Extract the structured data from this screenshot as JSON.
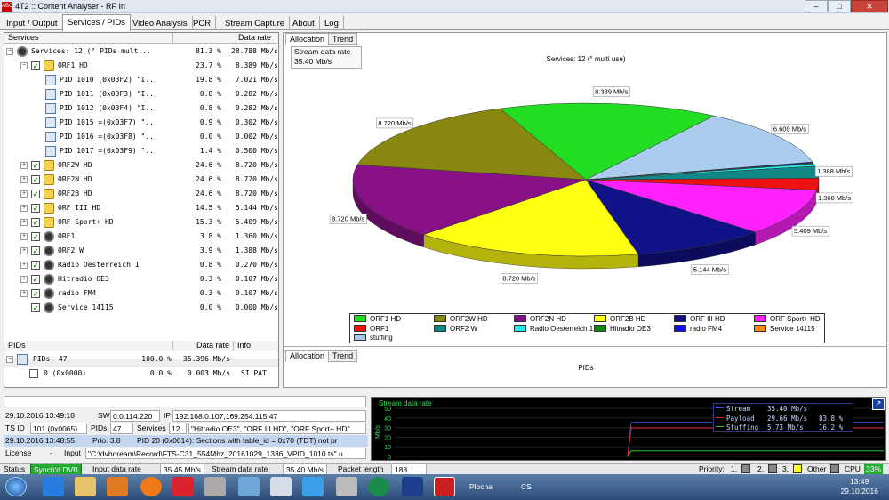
{
  "window": {
    "title": "4T2 :: Content Analyser - RF In",
    "min": "–",
    "max": "□",
    "close": "✕",
    "app_icon_text": "ABC"
  },
  "tabs": [
    "Input / Output",
    "Services / PIDs",
    "Video Analysis",
    "PCR",
    "Stream Capture",
    "About",
    "Log"
  ],
  "services_header": {
    "col1": "Services",
    "col2": "Data rate"
  },
  "services_rows": [
    {
      "exp": "⊟",
      "name": "Services: 12 (° PIDs mult...",
      "pct": "81.3 %",
      "rate": "28.788 Mb/s"
    },
    {
      "exp": "⊟",
      "name": "ORF1 HD",
      "pct": "23.7 %",
      "rate": "8.389 Mb/s"
    },
    {
      "name": "PID 1010 (0x03F2) \"I...",
      "pct": "19.8 %",
      "rate": "7.021 Mb/s"
    },
    {
      "name": "PID 1011 (0x03F3) \"I...",
      "pct": "0.8 %",
      "rate": "0.282 Mb/s"
    },
    {
      "name": "PID 1012 (0x03F4) \"I...",
      "pct": "0.8 %",
      "rate": "0.282 Mb/s"
    },
    {
      "name": "PID 1015 =(0x03F7) \"...",
      "pct": "0.9 %",
      "rate": "0.302 Mb/s"
    },
    {
      "name": "PID 1016 =(0x03F8) \"...",
      "pct": "0.0 %",
      "rate": "0.002 Mb/s"
    },
    {
      "name": "PID 1017 =(0x03F9) \"...",
      "pct": "1.4 %",
      "rate": "0.500 Mb/s"
    },
    {
      "exp": "⊞",
      "name": "ORF2W HD",
      "pct": "24.6 %",
      "rate": "8.720 Mb/s"
    },
    {
      "exp": "⊞",
      "name": "ORF2N HD",
      "pct": "24.6 %",
      "rate": "8.720 Mb/s"
    },
    {
      "exp": "⊞",
      "name": "ORF2B HD",
      "pct": "24.6 %",
      "rate": "8.720 Mb/s"
    },
    {
      "exp": "⊞",
      "name": "ORF III HD",
      "pct": "14.5 %",
      "rate": "5.144 Mb/s"
    },
    {
      "exp": "⊞",
      "name": "ORF Sport+ HD",
      "pct": "15.3 %",
      "rate": "5.409 Mb/s"
    },
    {
      "exp": "⊞",
      "name": "ORF1",
      "pct": "3.8 %",
      "rate": "1.360 Mb/s"
    },
    {
      "exp": "⊞",
      "name": "ORF2 W",
      "pct": "3.9 %",
      "rate": "1.388 Mb/s"
    },
    {
      "exp": "⊞",
      "name": "Radio Oesterreich 1",
      "pct": "0.8 %",
      "rate": "0.270 Mb/s"
    },
    {
      "exp": "⊞",
      "name": "Hitradio OE3",
      "pct": "0.3 %",
      "rate": "0.107 Mb/s"
    },
    {
      "exp": "⊞",
      "name": "radio FM4",
      "pct": "0.3 %",
      "rate": "0.107 Mb/s"
    },
    {
      "name": "Service 14115",
      "pct": "0.0 %",
      "rate": "0.000 Mb/s"
    }
  ],
  "pids_header": {
    "col1": "PIDs",
    "col2": "Data rate",
    "col3": "Info"
  },
  "pids_rows": [
    {
      "exp": "⊟",
      "name": "PIDs: 47",
      "pct": "100.0 %",
      "rate": "35.396 Mb/s",
      "info": ""
    },
    {
      "name": "0 (0x0000)",
      "pct": "0.0 %",
      "rate": "0.003 Mb/s",
      "info": "SI PAT"
    }
  ],
  "right_tabs": [
    "Allocation",
    "Trend"
  ],
  "stream_rate": {
    "label": "Stream data rate",
    "value": "35.40 Mb/s"
  },
  "pie_title": "Services: 12 (° multi use)",
  "pids_title": "PIDs",
  "colors": {
    "ORF1 HD": "#22dd22",
    "ORF2W HD": "#888811",
    "ORF2N HD": "#881188",
    "ORF2B HD": "#ffff11",
    "ORF III HD": "#111188",
    "ORF Sport+ HD": "#ff22ff",
    "ORF1": "#ee1111",
    "ORF2 W": "#118888",
    "Radio Oesterreich 1": "#22eeee",
    "Hitradio OE3": "#118811",
    "radio FM4": "#1111ee",
    "Service 14115": "#ff8811",
    "stuffing": "#aaccee"
  },
  "chart_data": {
    "type": "pie",
    "title": "Services: 12 (° multi use)",
    "slices": [
      {
        "name": "ORF1 HD",
        "value": 8.389,
        "label": "8.389 Mb/s"
      },
      {
        "name": "stuffing",
        "value": 6.609,
        "label": "6.609 Mb/s"
      },
      {
        "name": "radio FM4",
        "value": 0.107,
        "label": ""
      },
      {
        "name": "Hitradio OE3",
        "value": 0.107,
        "label": ""
      },
      {
        "name": "Radio Oesterreich 1",
        "value": 0.27,
        "label": ""
      },
      {
        "name": "ORF2 W",
        "value": 1.388,
        "label": "1.388 Mb/s"
      },
      {
        "name": "ORF1",
        "value": 1.36,
        "label": "1.360 Mb/s"
      },
      {
        "name": "ORF Sport+ HD",
        "value": 5.409,
        "label": "5.409 Mb/s"
      },
      {
        "name": "ORF III HD",
        "value": 5.144,
        "label": "5.144 Mb/s"
      },
      {
        "name": "ORF2B HD",
        "value": 8.72,
        "label": "8.720 Mb/s"
      },
      {
        "name": "ORF2N HD",
        "value": 8.72,
        "label": "8.720 Mb/s"
      },
      {
        "name": "ORF2W HD",
        "value": 8.72,
        "label": "8.720 Mb/s"
      }
    ],
    "legend": [
      "ORF1 HD",
      "ORF2W HD",
      "ORF2N HD",
      "ORF2B HD",
      "ORF III HD",
      "ORF Sport+ HD",
      "ORF1",
      "ORF2 W",
      "Radio Oesterreich 1",
      "Hitradio OE3",
      "radio FM4",
      "Service 14115",
      "stuffing"
    ]
  },
  "info": {
    "r1_time": "29.10.2016 13:49:18",
    "r1_sw_label": "SW",
    "r1_sw": "0.0.114.220",
    "r1_ip_label": "IP",
    "r1_ip": "192.168.0.107,169.254.115.47",
    "r2_tsid_label": "TS ID",
    "r2_tsid": "101 (0x0065)",
    "r2_pids_label": "PIDs",
    "r2_pids": "47",
    "r2_services_label": "Services",
    "r2_services": "12",
    "r2_names": "\"Hitradio OE3\", \"ORF III HD\", \"ORF Sport+ HD\"",
    "r3_time": "29.10.2016 13:48:55",
    "r3_prio": "Prio. 3.8",
    "r3_msg": "PID 20 (0x0014): Sections with table_id = 0x70 (TDT) not pr",
    "r4_license": "License",
    "r4_dash": "-",
    "r4_input_label": "Input",
    "r4_input": "\"C:\\dvbdream\\Record\\FTS-C31_554Mhz_20161029_1336_VPID_1010.ts\" u"
  },
  "graph": {
    "title": "Stream data rate",
    "ylabel": "Mb/s",
    "yticks": [
      "50",
      "40",
      "30",
      "20",
      "10",
      "0"
    ],
    "legend": [
      {
        "name": "Stream",
        "value": "35.40 Mb/s",
        "pct": "",
        "color": "#3355ff"
      },
      {
        "name": "Payload",
        "value": "29.66 Mb/s",
        "pct": "83.8 %",
        "color": "#ee2222"
      },
      {
        "name": "Stuffing",
        "value": "5.73 Mb/s",
        "pct": "16.2 %",
        "color": "#22cc22"
      }
    ],
    "zoom": "↗"
  },
  "status": {
    "status_label": "Status",
    "status_value": "Synch'd DVB",
    "input_label": "Input data rate",
    "input_value": "35.45 Mb/s",
    "stream_label": "Stream data rate",
    "stream_value": "35.40 Mb/s",
    "packet_label": "Packet length",
    "packet_value": "188",
    "priority_label": "Priority:",
    "p1": "1.",
    "p2": "2.",
    "p3": "3.",
    "other": "Other",
    "cpu_label": "CPU",
    "cpu_value": "33%"
  },
  "taskbar": {
    "plocha": "Plocha",
    "lang": "CS",
    "time": "13:49",
    "date": "29.10.2016"
  }
}
